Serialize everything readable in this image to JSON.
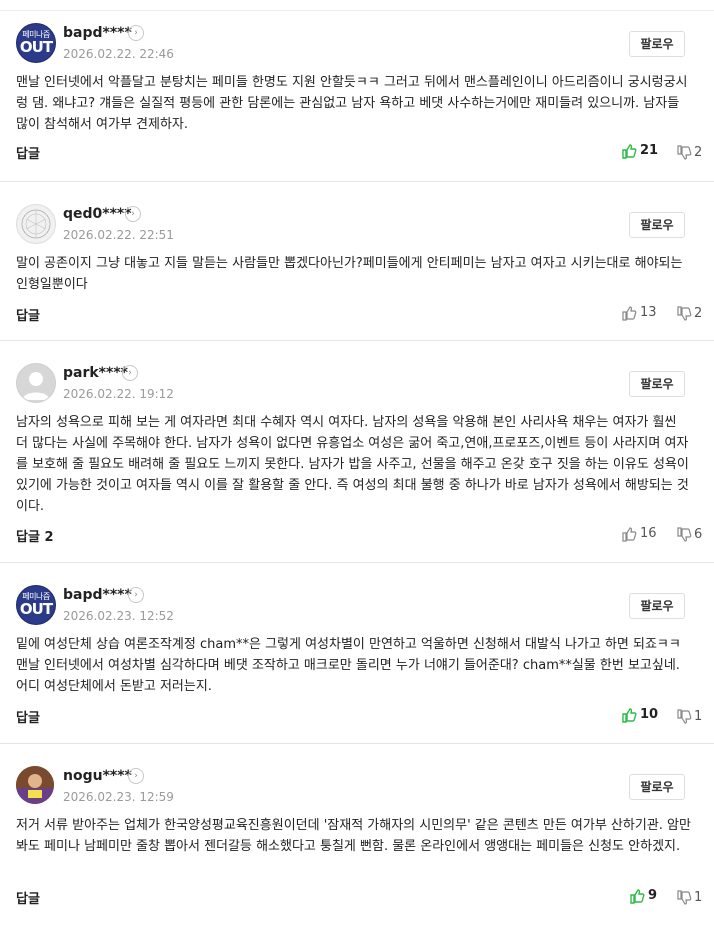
{
  "follow_label": "팔로우",
  "colors": {
    "like_active": "#2fb94a",
    "text": "#222222",
    "meta": "#9a9a9a"
  },
  "comments": [
    {
      "username": "bapd****",
      "date": "2026.02.22. 22:46",
      "avatar": {
        "type": "logo",
        "line1": "페미나즘",
        "line2": "OUT"
      },
      "text": "맨날 인터넷에서 악플달고 분탕치는 페미들 한명도 지원 안할듯ㅋㅋ 그러고 뒤에서 맨스플레인이니 아드리즘이니 궁시렁궁시렁 댐. 왜냐고? 걔들은 실질적 평등에 관한 담론에는 관심없고 남자 욕하고 베댓 사수하는거에만 재미들려 있으니까. 남자들 많이 참석해서 여가부 견제하자.",
      "reply": "답글",
      "likes": "21",
      "dislikes": "2",
      "liked": true
    },
    {
      "username": "qed0****",
      "date": "2026.02.22. 22:51",
      "avatar": {
        "type": "sketch"
      },
      "text": "말이 공존이지 그냥 대놓고 지들 말듣는 사람들만 뽑겠다아닌가?페미들에게 안티페미는 남자고 여자고 시키는대로 해야되는 인형일뿐이다",
      "reply": "답글",
      "likes": "13",
      "dislikes": "2",
      "liked": false
    },
    {
      "username": "park****",
      "date": "2026.02.22. 19:12",
      "avatar": {
        "type": "default"
      },
      "text": "남자의 성욕으로 피해 보는 게 여자라면 최대 수혜자 역시 여자다. 남자의 성욕을 악용해 본인 사리사욕 채우는 여자가 훨씬 더 많다는 사실에 주목해야 한다. 남자가 성욕이 없다면 유흥업소 여성은 굶어 죽고,연애,프로포즈,이벤트 등이 사라지며 여자를 보호해 줄 필요도 배려해 줄 필요도 느끼지 못한다. 남자가 밥을 사주고, 선물을 해주고 온갖 호구 짓을 하는 이유도 성욕이 있기에 가능한 것이고 여자들 역시 이를 잘 활용할 줄 안다. 즉 여성의 최대 불행 중 하나가 바로 남자가 성욕에서 해방되는 것이다.",
      "reply": "답글 2",
      "likes": "16",
      "dislikes": "6",
      "liked": false
    },
    {
      "username": "bapd****",
      "date": "2026.02.23. 12:52",
      "avatar": {
        "type": "logo",
        "line1": "페미나즘",
        "line2": "OUT"
      },
      "text": "밑에 여성단체 상습 여론조작계정 cham**은 그렇게 여성차별이 만연하고 억울하면 신청해서 대발식 나가고 하면 되죠ㅋㅋ 맨날 인터넷에서 여성차별 심각하다며 베댓 조작하고 매크로만 돌리면 누가 너얘기 들어준대? cham**실물 한번 보고싶네. 어디 여성단체에서 돈받고 저러는지.",
      "reply": "답글",
      "likes": "10",
      "dislikes": "1",
      "liked": true
    },
    {
      "username": "nogu****",
      "date": "2026.02.23. 12:59",
      "avatar": {
        "type": "photo"
      },
      "text": "저거 서류 받아주는 업체가 한국양성평교육진흥원이던데 '잠재적 가해자의 시민의무' 같은 콘텐츠 만든 여가부 산하기관. 암만봐도 페미나 남페미만 줄창 뽑아서 젠더갈등 해소했다고 퉁칠게 뻔함. 물론 온라인에서 앵앵대는 페미들은 신청도 안하겠지.",
      "reply": "답글",
      "likes": "9",
      "dislikes": "1",
      "liked": true
    }
  ]
}
